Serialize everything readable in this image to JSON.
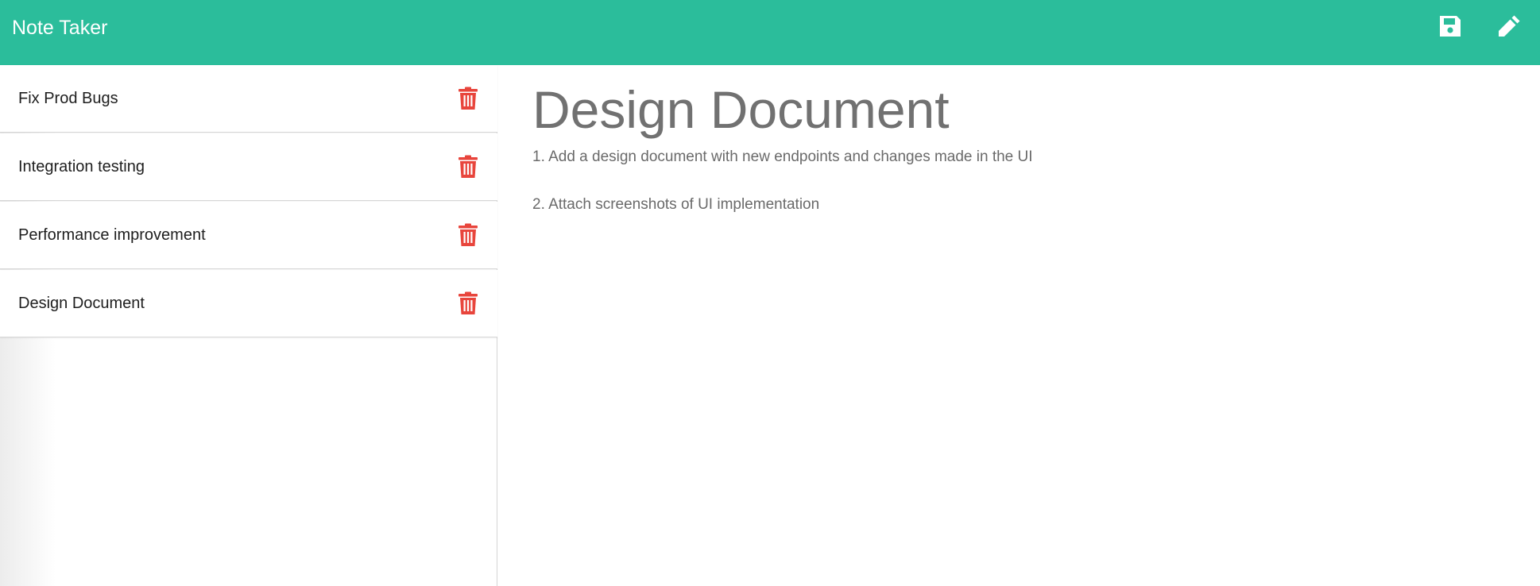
{
  "app": {
    "title": "Note Taker",
    "accent_color": "#2bbd9b",
    "delete_color": "#e8453c"
  },
  "toolbar": {
    "save_icon": "save-icon",
    "edit_icon": "pencil-icon"
  },
  "sidebar": {
    "notes": [
      {
        "title": "Fix Prod Bugs",
        "icon": "trash-icon"
      },
      {
        "title": "Integration testing",
        "icon": "trash-icon"
      },
      {
        "title": "Performance improvement",
        "icon": "trash-icon"
      },
      {
        "title": "Design Document",
        "icon": "trash-icon"
      }
    ]
  },
  "editor": {
    "title": "Design Document",
    "body_lines": [
      "1. Add a design document with new endpoints and changes made in the UI",
      "2. Attach screenshots of UI implementation"
    ]
  }
}
